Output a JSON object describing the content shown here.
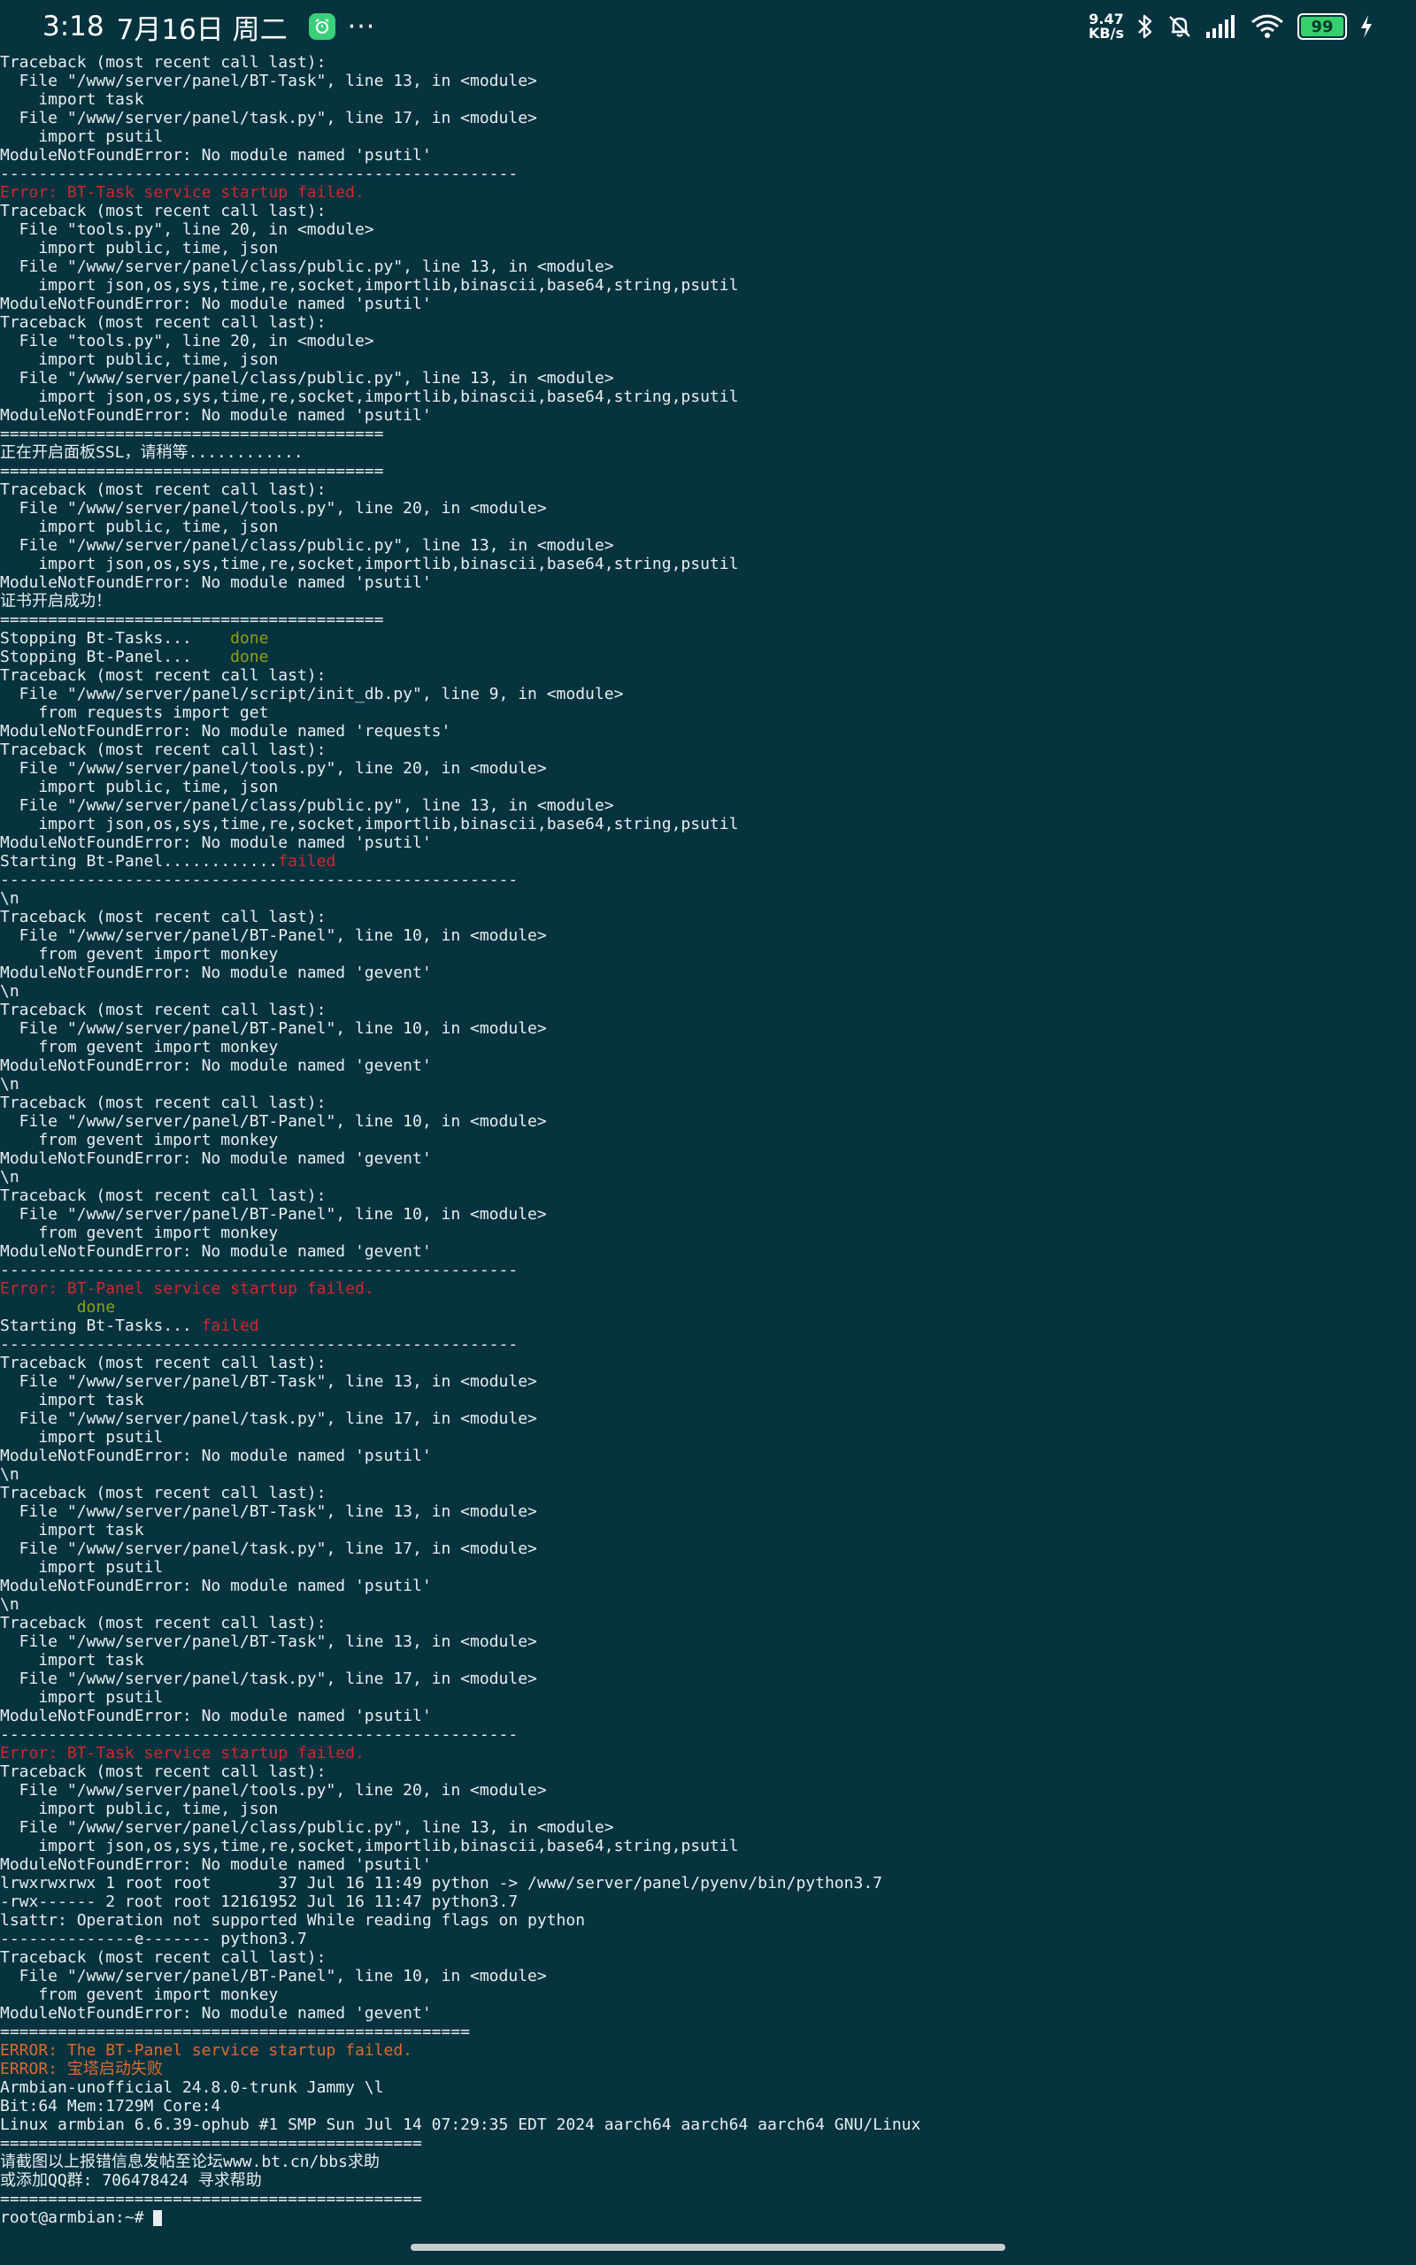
{
  "status_bar": {
    "time": "3:18",
    "date": "7月16日 周二",
    "dots": "···",
    "net_speed_value": "9.47",
    "net_speed_unit": "KB/s",
    "battery": "99",
    "colors": {
      "battery_fill": "#35d06b",
      "app_badge": "#3ad07a"
    },
    "icons": [
      "alarm-app-icon",
      "bluetooth-icon",
      "mute-bell-icon",
      "signal-icon",
      "wifi-icon",
      "battery-icon",
      "charging-icon"
    ]
  },
  "terminal": {
    "colors": {
      "background": "#07333f",
      "text": "#e8eef0",
      "error_red": "#d0262f",
      "error_orange": "#e06a2c",
      "done_green": "#8fa016"
    },
    "lines": [
      {
        "text": "Traceback (most recent call last):"
      },
      {
        "text": "  File \"/www/server/panel/BT-Task\", line 13, in <module>"
      },
      {
        "text": "    import task"
      },
      {
        "text": "  File \"/www/server/panel/task.py\", line 17, in <module>"
      },
      {
        "text": "    import psutil"
      },
      {
        "text": "ModuleNotFoundError: No module named 'psutil'"
      },
      {
        "text": "------------------------------------------------------"
      },
      {
        "text": "Error: BT-Task service startup failed.",
        "color": "red"
      },
      {
        "text": "Traceback (most recent call last):"
      },
      {
        "text": "  File \"tools.py\", line 20, in <module>"
      },
      {
        "text": "    import public, time, json"
      },
      {
        "text": "  File \"/www/server/panel/class/public.py\", line 13, in <module>"
      },
      {
        "text": "    import json,os,sys,time,re,socket,importlib,binascii,base64,string,psutil"
      },
      {
        "text": "ModuleNotFoundError: No module named 'psutil'"
      },
      {
        "text": "Traceback (most recent call last):"
      },
      {
        "text": "  File \"tools.py\", line 20, in <module>"
      },
      {
        "text": "    import public, time, json"
      },
      {
        "text": "  File \"/www/server/panel/class/public.py\", line 13, in <module>"
      },
      {
        "text": "    import json,os,sys,time,re,socket,importlib,binascii,base64,string,psutil"
      },
      {
        "text": "ModuleNotFoundError: No module named 'psutil'"
      },
      {
        "text": "========================================"
      },
      {
        "text": "正在开启面板SSL，请稍等............"
      },
      {
        "text": "========================================"
      },
      {
        "text": "Traceback (most recent call last):"
      },
      {
        "text": "  File \"/www/server/panel/tools.py\", line 20, in <module>"
      },
      {
        "text": "    import public, time, json"
      },
      {
        "text": "  File \"/www/server/panel/class/public.py\", line 13, in <module>"
      },
      {
        "text": "    import json,os,sys,time,re,socket,importlib,binascii,base64,string,psutil"
      },
      {
        "text": "ModuleNotFoundError: No module named 'psutil'"
      },
      {
        "text": "证书开启成功！"
      },
      {
        "text": "========================================"
      },
      {
        "text": "Stopping Bt-Tasks...    ",
        "tail": "done",
        "tail_color": "green"
      },
      {
        "text": "Stopping Bt-Panel...    ",
        "tail": "done",
        "tail_color": "green"
      },
      {
        "text": "Traceback (most recent call last):"
      },
      {
        "text": "  File \"/www/server/panel/script/init_db.py\", line 9, in <module>"
      },
      {
        "text": "    from requests import get"
      },
      {
        "text": "ModuleNotFoundError: No module named 'requests'"
      },
      {
        "text": "Traceback (most recent call last):"
      },
      {
        "text": "  File \"/www/server/panel/tools.py\", line 20, in <module>"
      },
      {
        "text": "    import public, time, json"
      },
      {
        "text": "  File \"/www/server/panel/class/public.py\", line 13, in <module>"
      },
      {
        "text": "    import json,os,sys,time,re,socket,importlib,binascii,base64,string,psutil"
      },
      {
        "text": "ModuleNotFoundError: No module named 'psutil'"
      },
      {
        "text": "Starting Bt-Panel............",
        "tail": "failed",
        "tail_color": "red"
      },
      {
        "text": "------------------------------------------------------"
      },
      {
        "text": "\\n"
      },
      {
        "text": "Traceback (most recent call last):"
      },
      {
        "text": "  File \"/www/server/panel/BT-Panel\", line 10, in <module>"
      },
      {
        "text": "    from gevent import monkey"
      },
      {
        "text": "ModuleNotFoundError: No module named 'gevent'"
      },
      {
        "text": "\\n"
      },
      {
        "text": "Traceback (most recent call last):"
      },
      {
        "text": "  File \"/www/server/panel/BT-Panel\", line 10, in <module>"
      },
      {
        "text": "    from gevent import monkey"
      },
      {
        "text": "ModuleNotFoundError: No module named 'gevent'"
      },
      {
        "text": "\\n"
      },
      {
        "text": "Traceback (most recent call last):"
      },
      {
        "text": "  File \"/www/server/panel/BT-Panel\", line 10, in <module>"
      },
      {
        "text": "    from gevent import monkey"
      },
      {
        "text": "ModuleNotFoundError: No module named 'gevent'"
      },
      {
        "text": "\\n"
      },
      {
        "text": "Traceback (most recent call last):"
      },
      {
        "text": "  File \"/www/server/panel/BT-Panel\", line 10, in <module>"
      },
      {
        "text": "    from gevent import monkey"
      },
      {
        "text": "ModuleNotFoundError: No module named 'gevent'"
      },
      {
        "text": "------------------------------------------------------"
      },
      {
        "text": "Error: BT-Panel service startup failed.",
        "color": "red"
      },
      {
        "text": "        ",
        "tail": "done",
        "tail_color": "green"
      },
      {
        "text": "Starting Bt-Tasks... ",
        "tail": "failed",
        "tail_color": "red"
      },
      {
        "text": "------------------------------------------------------"
      },
      {
        "text": "Traceback (most recent call last):"
      },
      {
        "text": "  File \"/www/server/panel/BT-Task\", line 13, in <module>"
      },
      {
        "text": "    import task"
      },
      {
        "text": "  File \"/www/server/panel/task.py\", line 17, in <module>"
      },
      {
        "text": "    import psutil"
      },
      {
        "text": "ModuleNotFoundError: No module named 'psutil'"
      },
      {
        "text": "\\n"
      },
      {
        "text": "Traceback (most recent call last):"
      },
      {
        "text": "  File \"/www/server/panel/BT-Task\", line 13, in <module>"
      },
      {
        "text": "    import task"
      },
      {
        "text": "  File \"/www/server/panel/task.py\", line 17, in <module>"
      },
      {
        "text": "    import psutil"
      },
      {
        "text": "ModuleNotFoundError: No module named 'psutil'"
      },
      {
        "text": "\\n"
      },
      {
        "text": "Traceback (most recent call last):"
      },
      {
        "text": "  File \"/www/server/panel/BT-Task\", line 13, in <module>"
      },
      {
        "text": "    import task"
      },
      {
        "text": "  File \"/www/server/panel/task.py\", line 17, in <module>"
      },
      {
        "text": "    import psutil"
      },
      {
        "text": "ModuleNotFoundError: No module named 'psutil'"
      },
      {
        "text": "------------------------------------------------------"
      },
      {
        "text": "Error: BT-Task service startup failed.",
        "color": "red"
      },
      {
        "text": "Traceback (most recent call last):"
      },
      {
        "text": "  File \"/www/server/panel/tools.py\", line 20, in <module>"
      },
      {
        "text": "    import public, time, json"
      },
      {
        "text": "  File \"/www/server/panel/class/public.py\", line 13, in <module>"
      },
      {
        "text": "    import json,os,sys,time,re,socket,importlib,binascii,base64,string,psutil"
      },
      {
        "text": "ModuleNotFoundError: No module named 'psutil'"
      },
      {
        "text": "lrwxrwxrwx 1 root root       37 Jul 16 11:49 python -> /www/server/panel/pyenv/bin/python3.7"
      },
      {
        "text": "-rwx------ 2 root root 12161952 Jul 16 11:47 python3.7"
      },
      {
        "text": "lsattr: Operation not supported While reading flags on python"
      },
      {
        "text": "--------------e------- python3.7"
      },
      {
        "text": "Traceback (most recent call last):"
      },
      {
        "text": "  File \"/www/server/panel/BT-Panel\", line 10, in <module>"
      },
      {
        "text": "    from gevent import monkey"
      },
      {
        "text": "ModuleNotFoundError: No module named 'gevent'"
      },
      {
        "text": "================================================="
      },
      {
        "text": "ERROR: The BT-Panel service startup failed.",
        "color": "orange"
      },
      {
        "text": "ERROR: 宝塔启动失败",
        "color": "orange"
      },
      {
        "text": "Armbian-unofficial 24.8.0-trunk Jammy \\l"
      },
      {
        "text": "Bit:64 Mem:1729M Core:4"
      },
      {
        "text": "Linux armbian 6.6.39-ophub #1 SMP Sun Jul 14 07:29:35 EDT 2024 aarch64 aarch64 aarch64 GNU/Linux"
      },
      {
        "text": "============================================"
      },
      {
        "text": "请截图以上报错信息发帖至论坛www.bt.cn/bbs求助"
      },
      {
        "text": "或添加QQ群: 706478424 寻求帮助"
      },
      {
        "text": "============================================"
      },
      {
        "text": "root@armbian:~# ",
        "cursor": true
      }
    ]
  }
}
